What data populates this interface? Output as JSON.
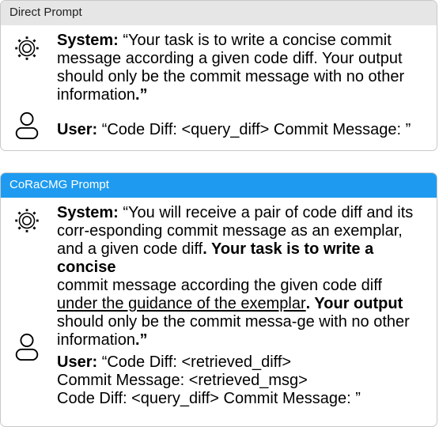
{
  "direct": {
    "header": "Direct Prompt",
    "system_label": "System:",
    "system_text_1": "“Your task is to write a concise commit",
    "system_text_2": "message according a given code diff. Your output",
    "system_text_3": "should only be the commit message with no other",
    "system_text_4": "information",
    "system_end": ".”",
    "user_label": "User:",
    "user_text": "“Code Diff: <query_diff> Commit Message: ”"
  },
  "coracmg": {
    "header": "CoRaCMG Prompt",
    "system_label": "System:",
    "system_text_1": "“You will receive a pair of code diff and its",
    "system_text_2": "corr-esponding commit message as an exemplar,",
    "system_text_3": "and a given code diff",
    "system_text_3_end": ". Your task is to write a concise",
    "system_text_4": "commit message according the given code diff",
    "system_text_5_underlined": "under the guidance of the exemplar",
    "system_text_5_end": ". Your output",
    "system_text_6": "should only be the commit messa-ge with no other",
    "system_text_7": "information",
    "system_end": ".”",
    "user_label": "User:",
    "user_line_1": "“Code Diff: <retrieved_diff>",
    "user_line_2": "Commit Message: <retrieved_msg>",
    "user_line_3": "Code Diff: <query_diff> Commit Message: ”"
  },
  "icons": {
    "system": "gear-icon",
    "user": "user-icon"
  }
}
